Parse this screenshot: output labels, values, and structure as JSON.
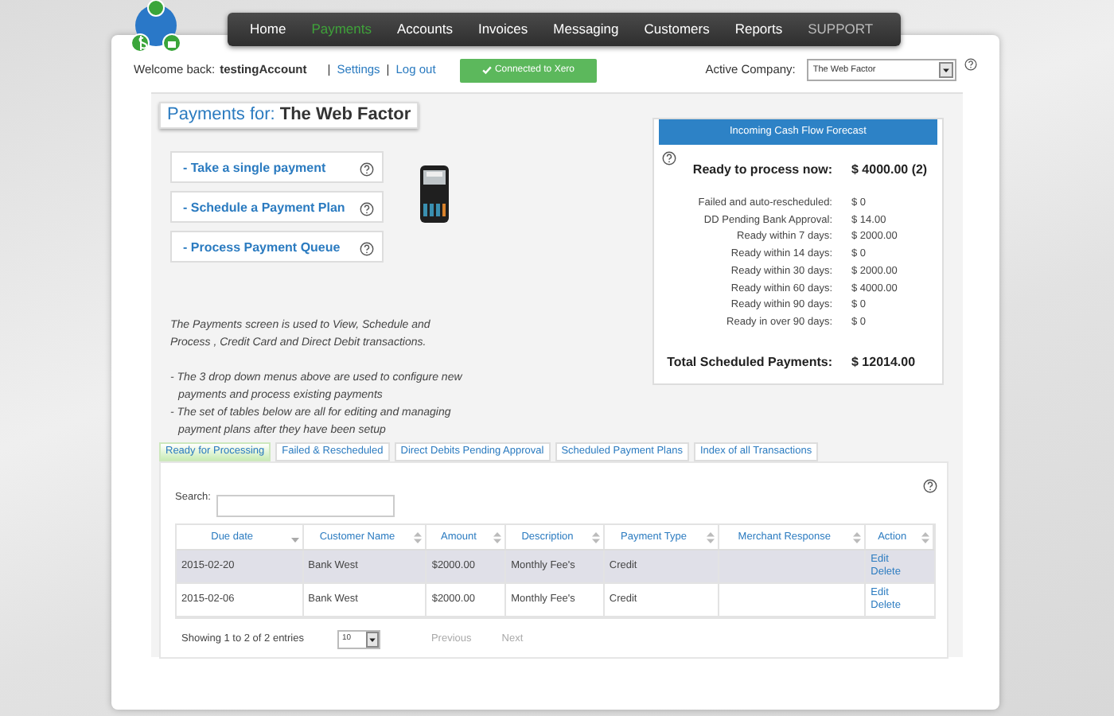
{
  "nav": [
    {
      "label": "Home",
      "selected": false
    },
    {
      "label": "Payments",
      "selected": true
    },
    {
      "label": "Accounts",
      "selected": false
    },
    {
      "label": "Invoices",
      "selected": false
    },
    {
      "label": "Messaging",
      "selected": false
    },
    {
      "label": "Customers",
      "selected": false
    },
    {
      "label": "Reports",
      "selected": false
    },
    {
      "label": "SUPPORT",
      "selected": false,
      "kind": "muted"
    }
  ],
  "header": {
    "welcome": "Welcome back:",
    "user": "testingAccount",
    "separator_1": "|",
    "settings": "Settings",
    "separator_2": "|",
    "logout": "Log out",
    "status": "Connected to Xero",
    "company_label": "Active Company:",
    "company": "The Web Factor"
  },
  "page_title": {
    "prefix": "Payments for:",
    "name": "The Web Factor"
  },
  "actions": [
    "- Take a single payment",
    "- Schedule a Payment Plan",
    "- Process Payment Queue"
  ],
  "description": [
    "The Payments screen is used to View, Schedule and Process , Credit Card and Direct Debit transactions.",
    "- The 3 drop down menus above are used to configure new payments and process existing payments",
    "- The set of tables below are all for editing and managing payment plans after they have been setup"
  ],
  "forecast": {
    "title": "Incoming Cash Flow Forecast",
    "ready_label": "Ready to process now:",
    "ready_value": "$ 4000.00 (2)",
    "rows": [
      {
        "label": "Failed and auto-rescheduled:",
        "value": "$ 0"
      },
      {
        "label": "DD Pending Bank Approval:",
        "value": "$ 14.00"
      },
      {
        "label": "Ready within 7 days:",
        "value": "$ 2000.00"
      },
      {
        "label": "Ready within 14 days:",
        "value": "$ 0"
      },
      {
        "label": "Ready within 30 days:",
        "value": "$ 2000.00"
      },
      {
        "label": "Ready within 60 days:",
        "value": "$ 4000.00"
      },
      {
        "label": "Ready within 90 days:",
        "value": "$ 0"
      },
      {
        "label": "Ready in over 90 days:",
        "value": "$ 0"
      }
    ],
    "total_label": "Total Scheduled Payments:",
    "total_value": "$ 12014.00"
  },
  "tabs": [
    {
      "label": "Ready for Processing",
      "selected": true
    },
    {
      "label": "Failed & Rescheduled",
      "selected": false
    },
    {
      "label": "Direct Debits Pending Approval",
      "selected": false
    },
    {
      "label": "Scheduled Payment Plans",
      "selected": false
    },
    {
      "label": "Index of all Transactions",
      "selected": false
    }
  ],
  "table": {
    "search_label": "Search:",
    "columns": [
      {
        "label": "Due date",
        "sorted": true
      },
      {
        "label": "Customer Name",
        "sorted": false
      },
      {
        "label": "Amount",
        "sorted": false
      },
      {
        "label": "Description",
        "sorted": false
      },
      {
        "label": "Payment Type",
        "sorted": false
      },
      {
        "label": "Merchant Response",
        "sorted": false
      },
      {
        "label": "Action",
        "sorted": false
      }
    ],
    "rows": [
      {
        "selected": true,
        "cells": [
          "2015-02-20",
          "Bank West",
          "$2000.00",
          "Monthly Fee's",
          "Credit",
          ""
        ],
        "actions": [
          "Edit",
          "Delete"
        ]
      },
      {
        "selected": false,
        "cells": [
          "2015-02-06",
          "Bank West",
          "$2000.00",
          "Monthly Fee's",
          "Credit",
          ""
        ],
        "actions": [
          "Edit",
          "Delete"
        ]
      }
    ],
    "info": "Showing 1 to 2 of 2 entries",
    "page_size": "10",
    "previous": "Previous",
    "next": "Next"
  }
}
